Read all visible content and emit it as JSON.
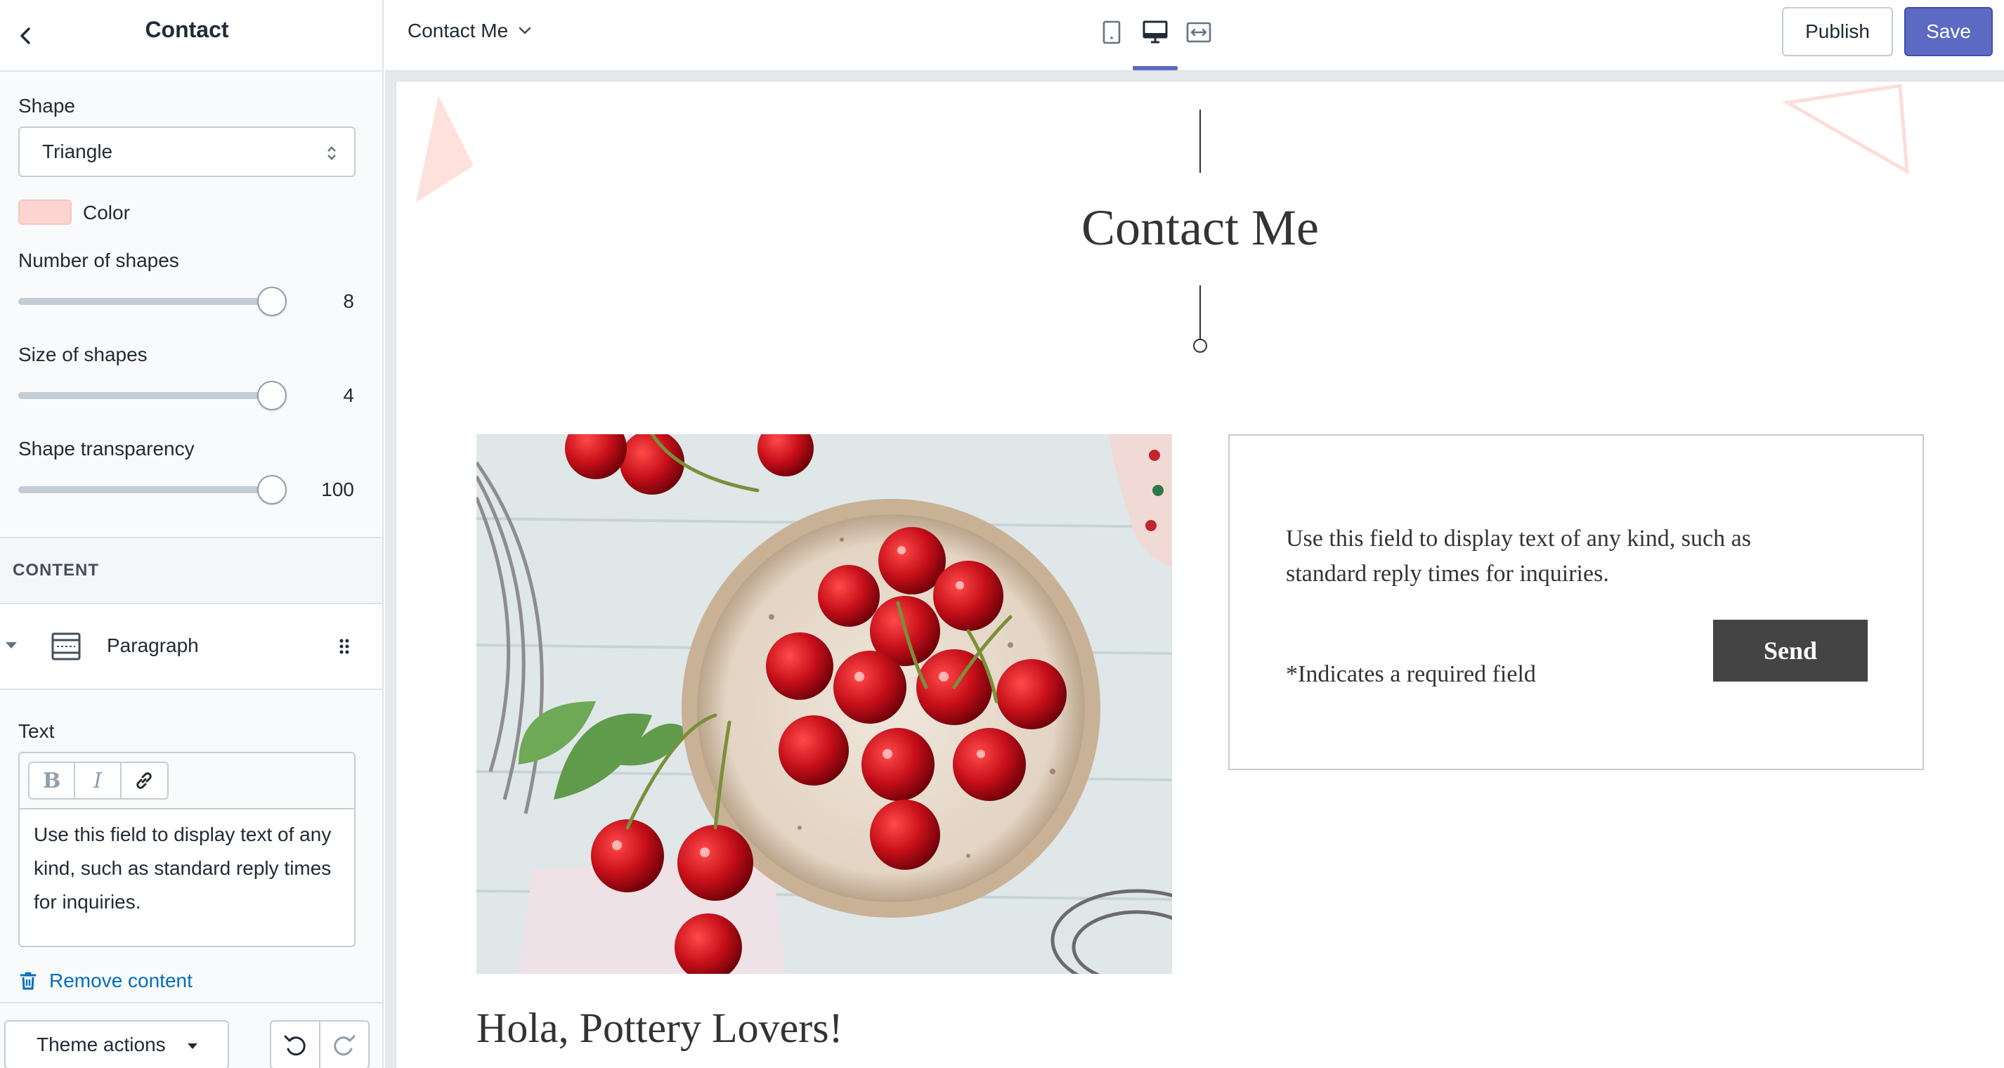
{
  "sidebar": {
    "title": "Contact",
    "shape": {
      "label": "Shape",
      "value": "Triangle"
    },
    "color": {
      "label": "Color",
      "value": "#fdd4cf"
    },
    "sliders": [
      {
        "label": "Number of shapes",
        "value": "8",
        "fraction": 1.0
      },
      {
        "label": "Size of shapes",
        "value": "4",
        "fraction": 1.0
      },
      {
        "label": "Shape transparency",
        "value": "100",
        "fraction": 1.0
      }
    ],
    "content_header": "CONTENT",
    "content_item": "Paragraph",
    "text_field": {
      "label": "Text",
      "bold": "B",
      "italic": "I",
      "value": "Use this field to display text of any kind, such as standard reply times for inquiries."
    },
    "remove_content": "Remove content",
    "theme_actions": "Theme actions"
  },
  "topbar": {
    "page": "Contact Me",
    "publish": "Publish",
    "save": "Save",
    "accent_color": "#5c6ac4"
  },
  "preview": {
    "title": "Contact Me",
    "body": "Use this field to display text of any kind, such as standard reply times for inquiries.",
    "required_note": "*Indicates a required field",
    "send": "Send",
    "footer_heading": "Hola, Pottery Lovers!",
    "shape_color": "#fdd4cf"
  }
}
